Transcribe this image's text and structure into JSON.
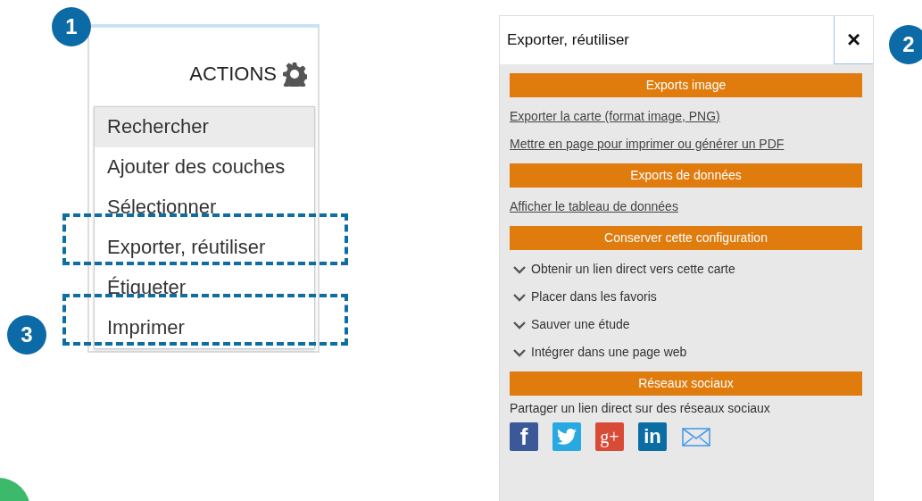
{
  "callouts": [
    {
      "number": "1"
    },
    {
      "number": "2"
    },
    {
      "number": "3"
    }
  ],
  "actions_panel": {
    "label": "ACTIONS",
    "menu": [
      {
        "label": "Rechercher",
        "selected": true,
        "highlighted": false
      },
      {
        "label": "Ajouter des couches",
        "selected": false,
        "highlighted": false
      },
      {
        "label": "Sélectionner",
        "selected": false,
        "highlighted": false
      },
      {
        "label": "Exporter, réutiliser",
        "selected": false,
        "highlighted": true
      },
      {
        "label": "Étiqueter",
        "selected": false,
        "highlighted": false
      },
      {
        "label": "Imprimer",
        "selected": false,
        "highlighted": true
      }
    ]
  },
  "export_panel": {
    "title": "Exporter, réutiliser",
    "close": "×",
    "sections": [
      {
        "heading": "Exports image",
        "items": [
          {
            "kind": "link",
            "label": "Exporter la carte (format image, PNG)"
          },
          {
            "kind": "link",
            "label": "Mettre en page pour imprimer ou générer un PDF"
          }
        ]
      },
      {
        "heading": "Exports de données",
        "items": [
          {
            "kind": "link",
            "label": "Afficher le tableau de données"
          }
        ]
      },
      {
        "heading": "Conserver cette configuration",
        "items": [
          {
            "kind": "expander",
            "label": "Obtenir un lien direct vers cette carte",
            "expanded": false
          },
          {
            "kind": "expander",
            "label": "Placer dans les favoris",
            "expanded": false
          },
          {
            "kind": "expander",
            "label": "Sauver une étude",
            "expanded": false
          },
          {
            "kind": "expander",
            "label": "Intégrer dans une page web",
            "expanded": false
          }
        ]
      },
      {
        "heading": "Réseaux sociaux",
        "items": [
          {
            "kind": "text",
            "label": "Partager un lien direct sur des réseaux sociaux"
          },
          {
            "kind": "social",
            "buttons": [
              {
                "kind": "facebook",
                "glyph": "f"
              },
              {
                "kind": "twitter"
              },
              {
                "kind": "googleplus",
                "glyph": "g+"
              },
              {
                "kind": "linkedin",
                "glyph": "in"
              },
              {
                "kind": "mail"
              }
            ]
          }
        ]
      }
    ]
  }
}
